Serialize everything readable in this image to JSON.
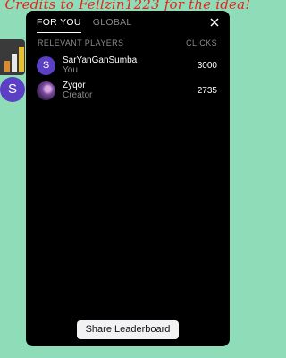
{
  "credits": "Credits to Fellzin1223 for the idea!",
  "side": {
    "avatar_letter": "S"
  },
  "tabs": [
    {
      "label": "FOR YOU",
      "active": true
    },
    {
      "label": "GLOBAL",
      "active": false
    }
  ],
  "table_header": {
    "players": "RELEVANT PLAYERS",
    "clicks": "CLICKS"
  },
  "players": [
    {
      "avatar": "S",
      "name": "SarYanGanSumba",
      "subtitle": "You",
      "clicks": "3000"
    },
    {
      "avatar": "profile-image",
      "name": "Zyqor",
      "subtitle": "Creator",
      "clicks": "2735"
    }
  ],
  "share_button": "Share Leaderboard",
  "colors": {
    "background": "#8fdcb8",
    "panel": "#000000",
    "credits": "#e8241c",
    "avatar_purple": "#5b3fc4"
  },
  "icons": {
    "close": "close-icon",
    "leaderboard": "leaderboard-icon"
  }
}
